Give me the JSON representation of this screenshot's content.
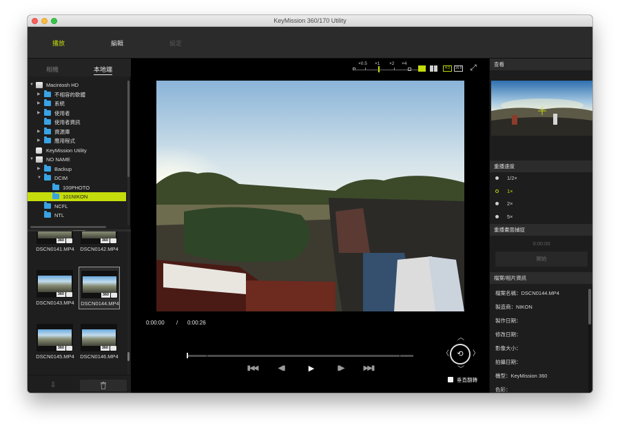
{
  "window": {
    "title": "KeyMission 360/170 Utility"
  },
  "nav_tabs": [
    {
      "label": "播放",
      "state": "active"
    },
    {
      "label": "編輯",
      "state": "normal"
    },
    {
      "label": "設定",
      "state": "disabled"
    }
  ],
  "source_tabs": [
    {
      "label": "相機",
      "active": false
    },
    {
      "label": "本地端",
      "active": true
    }
  ],
  "tree": [
    {
      "label": "Macintosh HD",
      "icon": "drive-icon",
      "level": 0,
      "expanded": true
    },
    {
      "label": "不相容的軟體",
      "icon": "folder-icon",
      "level": 1,
      "expanded": false
    },
    {
      "label": "系統",
      "icon": "folder-icon",
      "level": 1,
      "expanded": false
    },
    {
      "label": "使用者",
      "icon": "folder-icon",
      "level": 1,
      "expanded": false
    },
    {
      "label": "使用者資訊",
      "icon": "folder-icon",
      "level": 1,
      "expanded": null
    },
    {
      "label": "資源庫",
      "icon": "folder-icon",
      "level": 1,
      "expanded": false
    },
    {
      "label": "應用程式",
      "icon": "folder-icon",
      "level": 1,
      "expanded": false
    },
    {
      "label": "KeyMission Utility",
      "icon": "app-icon",
      "level": 0,
      "expanded": null
    },
    {
      "label": "NO NAME",
      "icon": "drive-icon",
      "level": 0,
      "expanded": true
    },
    {
      "label": "Backup",
      "icon": "folder-icon",
      "level": 1,
      "expanded": false
    },
    {
      "label": "DCIM",
      "icon": "folder-icon",
      "level": 1,
      "expanded": true
    },
    {
      "label": "100PHOTO",
      "icon": "folder-icon",
      "level": 2,
      "expanded": null
    },
    {
      "label": "101NIKON",
      "icon": "folder-icon",
      "level": 2,
      "expanded": null,
      "selected": true
    },
    {
      "label": "NCFL",
      "icon": "folder-icon",
      "level": 1,
      "expanded": null
    },
    {
      "label": "NTL",
      "icon": "folder-icon",
      "level": 1,
      "expanded": null
    }
  ],
  "thumbnails": [
    {
      "name": "DSCN0141.MP4",
      "badge": "360",
      "selected": false
    },
    {
      "name": "DSCN0142.MP4",
      "badge": "360",
      "selected": false
    },
    {
      "name": "DSCN0143.MP4",
      "badge": "360",
      "selected": false
    },
    {
      "name": "DSCN0144.MP4",
      "badge": "360",
      "selected": true
    },
    {
      "name": "DSCN0145.MP4",
      "badge": "360",
      "selected": false
    },
    {
      "name": "DSCN0146.MP4",
      "badge": "360",
      "selected": false
    }
  ],
  "zoom": {
    "labels": [
      "×0.5",
      "×1",
      "×2",
      "×4"
    ],
    "current": "×1"
  },
  "view_modes": [
    "4:3",
    "16:9"
  ],
  "player": {
    "current_time": "0:00:00",
    "separator": "/",
    "duration": "0:00:26",
    "progress": 0
  },
  "flip": {
    "label": "垂直翻轉",
    "checked": false
  },
  "right_panel": {
    "view_heading": "查看",
    "speed_heading": "重播速度",
    "speeds": [
      {
        "label": "1/2×",
        "selected": false
      },
      {
        "label": "1×",
        "selected": true
      },
      {
        "label": "2×",
        "selected": false
      },
      {
        "label": "5×",
        "selected": false
      }
    ],
    "capture_heading": "重播畫面捕捉",
    "capture_time": "0:00:00",
    "start_button": "開始",
    "info_heading": "檔案/相片資訊",
    "info_rows": [
      "檔案名稱：DSCN0144.MP4",
      "製造商：NIKON",
      "製作日期：",
      "修改日期：",
      "影像大小：",
      "拍攝日期：",
      "機型：KeyMission 360",
      "色彩："
    ]
  },
  "colors": {
    "accent": "#c4dc0c",
    "folder": "#39a3e5",
    "background": "#1b1b1b"
  }
}
